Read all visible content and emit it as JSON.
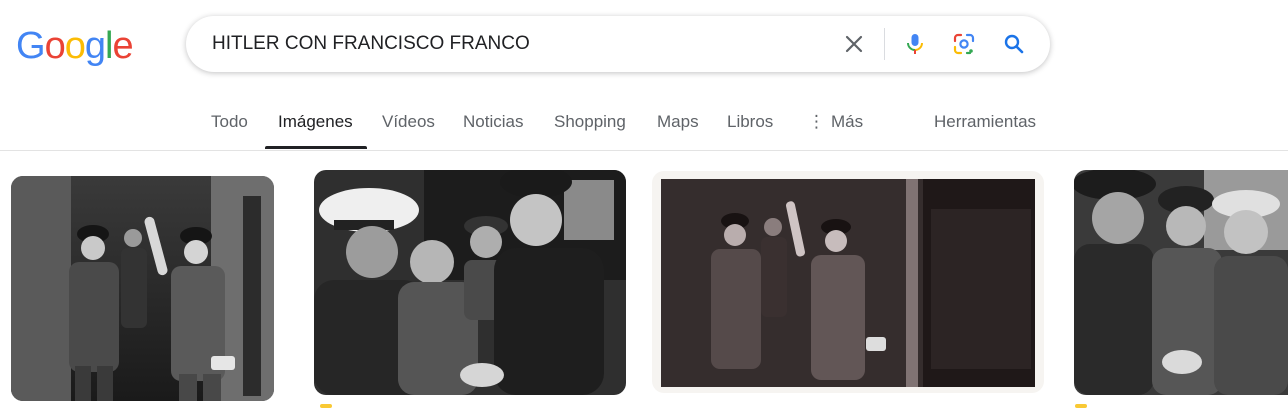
{
  "logo": {
    "letters": [
      "G",
      "o",
      "o",
      "g",
      "l",
      "e"
    ],
    "colors": [
      "#4285F4",
      "#EA4335",
      "#FBBC05",
      "#4285F4",
      "#34A853",
      "#EA4335"
    ]
  },
  "search": {
    "query": "HITLER CON FRANCISCO FRANCO",
    "placeholder": ""
  },
  "tabs": {
    "todo": "Todo",
    "imagenes": "Imágenes",
    "videos": "Vídeos",
    "noticias": "Noticias",
    "shopping": "Shopping",
    "maps": "Maps",
    "libros": "Libros",
    "mas": "Más",
    "herramientas": "Herramientas"
  },
  "icons": {
    "clear": "close-icon",
    "mic": "microphone-icon",
    "lens": "google-lens-icon",
    "search": "search-icon",
    "more": "vertical-dots-icon"
  },
  "colors": {
    "accent_blue": "#1a73e8",
    "tab_text": "#5f6368",
    "tab_active": "#202124",
    "divider": "#e3e3e3",
    "source_badge": "#f9c934"
  },
  "results": [
    {
      "name": "image-result-1"
    },
    {
      "name": "image-result-2"
    },
    {
      "name": "image-result-3"
    },
    {
      "name": "image-result-4"
    }
  ]
}
